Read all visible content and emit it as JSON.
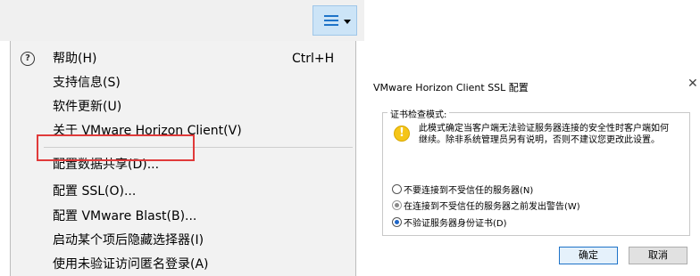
{
  "menu": {
    "items": [
      {
        "label": "帮助(H)",
        "shortcut": "Ctrl+H",
        "icon": "help-icon"
      },
      {
        "label": "支持信息(S)"
      },
      {
        "label": "软件更新(U)"
      },
      {
        "label": "关于 VMware Horizon Client(V)"
      },
      {
        "label": "配置数据共享(D)..."
      },
      {
        "label": "配置 SSL(O)..."
      },
      {
        "label": "配置 VMware Blast(B)..."
      },
      {
        "label": "启动某个项后隐藏选择器(I)"
      },
      {
        "label": "使用未验证访问匿名登录(A)"
      }
    ],
    "highlight_color": "#e03a3a"
  },
  "dialog": {
    "title": "VMware Horizon Client SSL 配置",
    "close": "✕",
    "group_label": "证书检查模式:",
    "warning_line1": "此模式确定当客户端无法验证服务器连接的安全性时客户端如何",
    "warning_line2": "继续。除非系统管理员另有说明，否则不建议您更改此设置。",
    "options": [
      {
        "label": "不要连接到不受信任的服务器(N)",
        "checked": false
      },
      {
        "label": "在连接到不受信任的服务器之前发出警告(W)",
        "checked": true,
        "disabled": true
      },
      {
        "label": "不验证服务器身份证书(D)",
        "checked": true
      }
    ],
    "ok_label": "确定",
    "cancel_label": "取消"
  }
}
